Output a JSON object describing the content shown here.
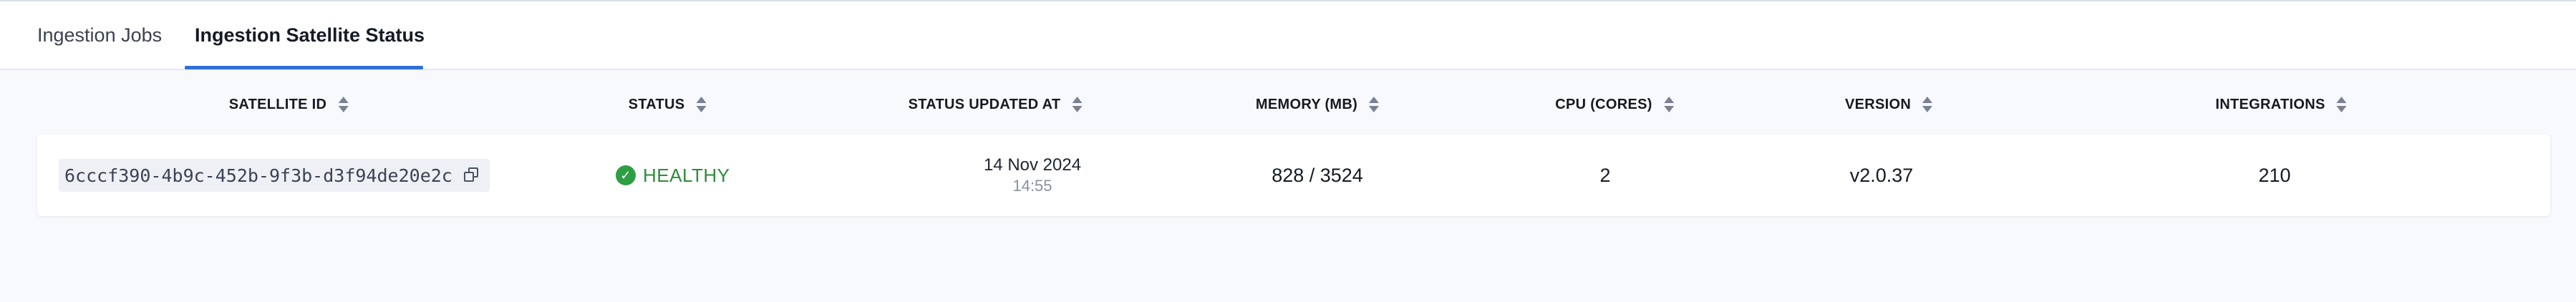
{
  "tabs": [
    {
      "label": "Ingestion Jobs",
      "active": false
    },
    {
      "label": "Ingestion Satellite Status",
      "active": true
    }
  ],
  "table": {
    "columns": [
      "SATELLITE ID",
      "STATUS",
      "STATUS UPDATED AT",
      "MEMORY (MB)",
      "CPU (CORES)",
      "VERSION",
      "INTEGRATIONS"
    ],
    "rows": [
      {
        "satellite_id": "6cccf390-4b9c-452b-9f3b-d3f94de20e2c",
        "status": "HEALTHY",
        "updated_date": "14 Nov 2024",
        "updated_time": "14:55",
        "memory": "828 / 3524",
        "cpu": "2",
        "version": "v2.0.37",
        "integrations": "210"
      }
    ]
  },
  "icons": {
    "sort": "sort-icon",
    "copy": "copy-icon",
    "status": "check-circle-icon"
  },
  "colors": {
    "accent": "#2f6fd6",
    "healthy": "#2e8b3a",
    "background": "#f8f9fc"
  }
}
